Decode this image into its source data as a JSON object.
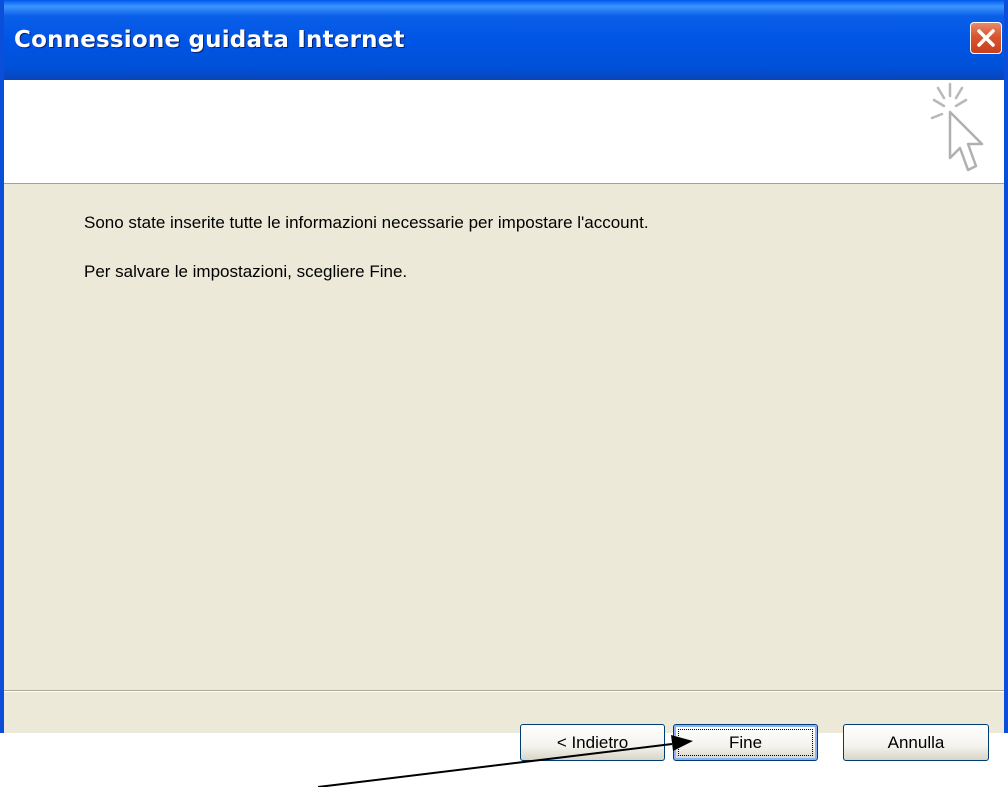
{
  "window": {
    "title": "Connessione guidata Internet",
    "close_icon": "close-icon"
  },
  "header": {
    "icon": "wizard-cursor-icon"
  },
  "content": {
    "line1": "Sono state inserite tutte le informazioni necessarie per impostare l'account.",
    "line2": "Per salvare le impostazioni, scegliere Fine."
  },
  "buttons": {
    "back": "< Indietro",
    "finish": "Fine",
    "cancel": "Annulla"
  },
  "annotation": {
    "icon": "pointer-arrow-icon"
  },
  "colors": {
    "titlebar": "#0055e5",
    "dialog_bg": "#ece9d8",
    "close_button": "#d8552e"
  }
}
